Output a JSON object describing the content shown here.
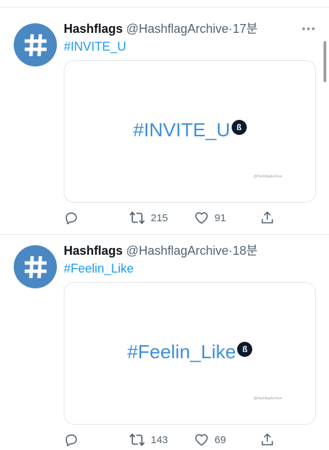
{
  "tweets": [
    {
      "name": "Hashflags",
      "handle": "@HashflagArchive",
      "separator": "·",
      "time": "17분",
      "hashtag": "#INVITE_U",
      "card_tag": "#INVITE_U",
      "watermark": "@HashflagArchive",
      "retweets": "215",
      "likes": "91"
    },
    {
      "name": "Hashflags",
      "handle": "@HashflagArchive",
      "separator": "·",
      "time": "18분",
      "hashtag": "#Feelin_Like",
      "card_tag": "#Feelin_Like",
      "watermark": "@HashflagArchive",
      "retweets": "143",
      "likes": "69"
    }
  ],
  "colors": {
    "avatar": "#4a88c4",
    "link": "#1d9bf0",
    "card_hashtag": "#3f8fdd",
    "muted": "#536471"
  },
  "icons": [
    "hash-avatar-icon",
    "more-icon",
    "reply-icon",
    "retweet-icon",
    "like-icon",
    "share-icon",
    "hashflag-emoji-icon"
  ]
}
